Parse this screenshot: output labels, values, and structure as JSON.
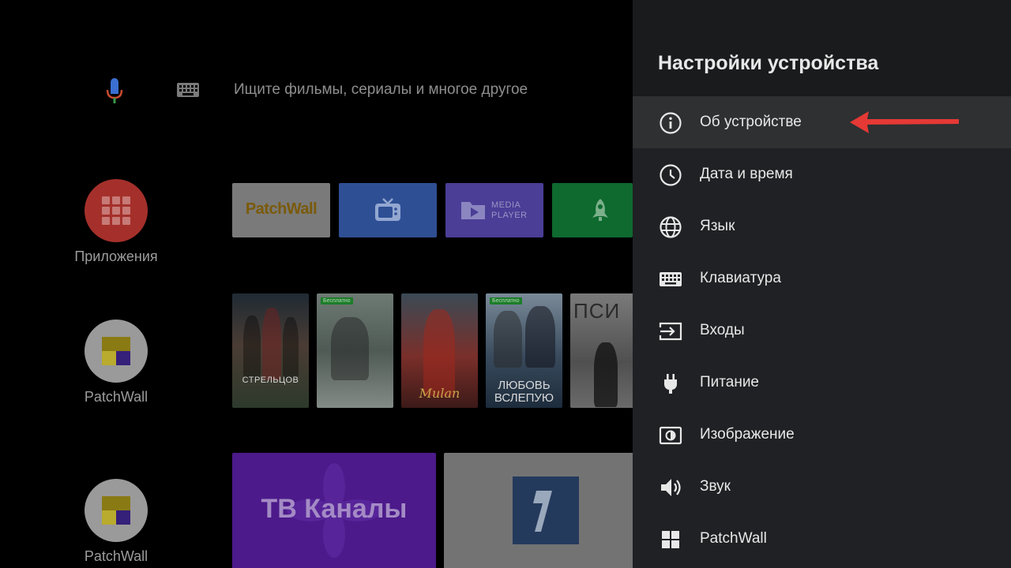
{
  "search": {
    "placeholder": "Ищите фильмы, сериалы и многое другое"
  },
  "sidebar": {
    "items": [
      {
        "label": "Приложения",
        "icon": "apps-grid-icon"
      },
      {
        "label": "PatchWall",
        "icon": "patchwall-icon"
      },
      {
        "label": "PatchWall",
        "icon": "patchwall-icon"
      }
    ]
  },
  "apps_row": {
    "tiles": [
      {
        "label": "PatchWall"
      },
      {
        "icon": "tv-icon"
      },
      {
        "label_line1": "MEDIA",
        "label_line2": "PLAYER"
      },
      {
        "icon": "rocket-icon"
      }
    ]
  },
  "content_row": {
    "posters": [
      {
        "title": "СТРЕЛЬЦОВ",
        "badge": ""
      },
      {
        "title": "",
        "badge": "Бесплатно"
      },
      {
        "title": "Mulan",
        "badge": ""
      },
      {
        "title_line1": "ЛЮБОВЬ",
        "title_line2": "ВСЛЕПУЮ",
        "badge": "Бесплатно"
      },
      {
        "title": "ПСИ",
        "badge": ""
      }
    ]
  },
  "channels_row": {
    "tiles": [
      {
        "label": "ТВ Каналы"
      },
      {
        "icon": "channel-one-logo"
      }
    ]
  },
  "settings": {
    "title": "Настройки устройства",
    "items": [
      {
        "label": "Об устройстве",
        "icon": "info-icon",
        "selected": true
      },
      {
        "label": "Дата и время",
        "icon": "clock-icon"
      },
      {
        "label": "Язык",
        "icon": "globe-icon"
      },
      {
        "label": "Клавиатура",
        "icon": "keyboard-icon"
      },
      {
        "label": "Входы",
        "icon": "input-icon"
      },
      {
        "label": "Питание",
        "icon": "power-plug-icon"
      },
      {
        "label": "Изображение",
        "icon": "picture-icon"
      },
      {
        "label": "Звук",
        "icon": "speaker-icon"
      },
      {
        "label": "PatchWall",
        "icon": "patchwall-icon"
      }
    ]
  },
  "colors": {
    "panel_bg": "#202124",
    "selected_bg": "#2e3032",
    "annotation_arrow": "#e53935"
  }
}
